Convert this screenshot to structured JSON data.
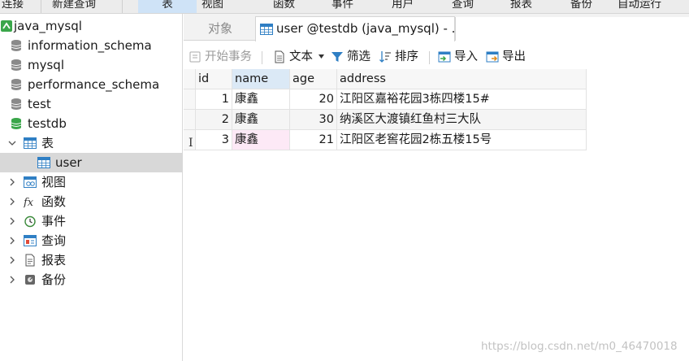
{
  "menubar": {
    "items": [
      "连接",
      "新建查询",
      "表",
      "视图",
      "函数",
      "事件",
      "用户",
      "查询",
      "报表",
      "备份",
      "自动运行"
    ],
    "active_index": 2
  },
  "sidebar": {
    "connection": "java_mysql",
    "databases": [
      "information_schema",
      "mysql",
      "performance_schema",
      "test",
      "testdb"
    ],
    "testdb_children": {
      "tables_label": "表",
      "table_name": "user",
      "views_label": "视图",
      "functions_label": "函数",
      "events_label": "事件",
      "queries_label": "查询",
      "reports_label": "报表",
      "backups_label": "备份"
    }
  },
  "tabs": {
    "objects_label": "对象",
    "active_label": "user @testdb (java_mysql) - ..."
  },
  "toolbar": {
    "begin_transaction": "开始事务",
    "text": "文本",
    "filter": "筛选",
    "sort": "排序",
    "import": "导入",
    "export": "导出"
  },
  "grid": {
    "columns": [
      "id",
      "name",
      "age",
      "address"
    ],
    "rows": [
      {
        "id": "1",
        "name": "康鑫",
        "age": "20",
        "address": "江阳区嘉裕花园3栋四楼15#"
      },
      {
        "id": "2",
        "name": "康鑫",
        "age": "30",
        "address": "纳溪区大渡镇红鱼村三大队"
      },
      {
        "id": "3",
        "name": "康鑫",
        "age": "21",
        "address": "江阳区老窖花园2栋五楼15号"
      }
    ],
    "cursor_glyph": "I"
  },
  "watermark": "https://blog.csdn.net/m0_46470018",
  "colors": {
    "accent": "#cfe3f7",
    "selected_row": "#d8d8d8",
    "db_green": "#3aa64a"
  }
}
